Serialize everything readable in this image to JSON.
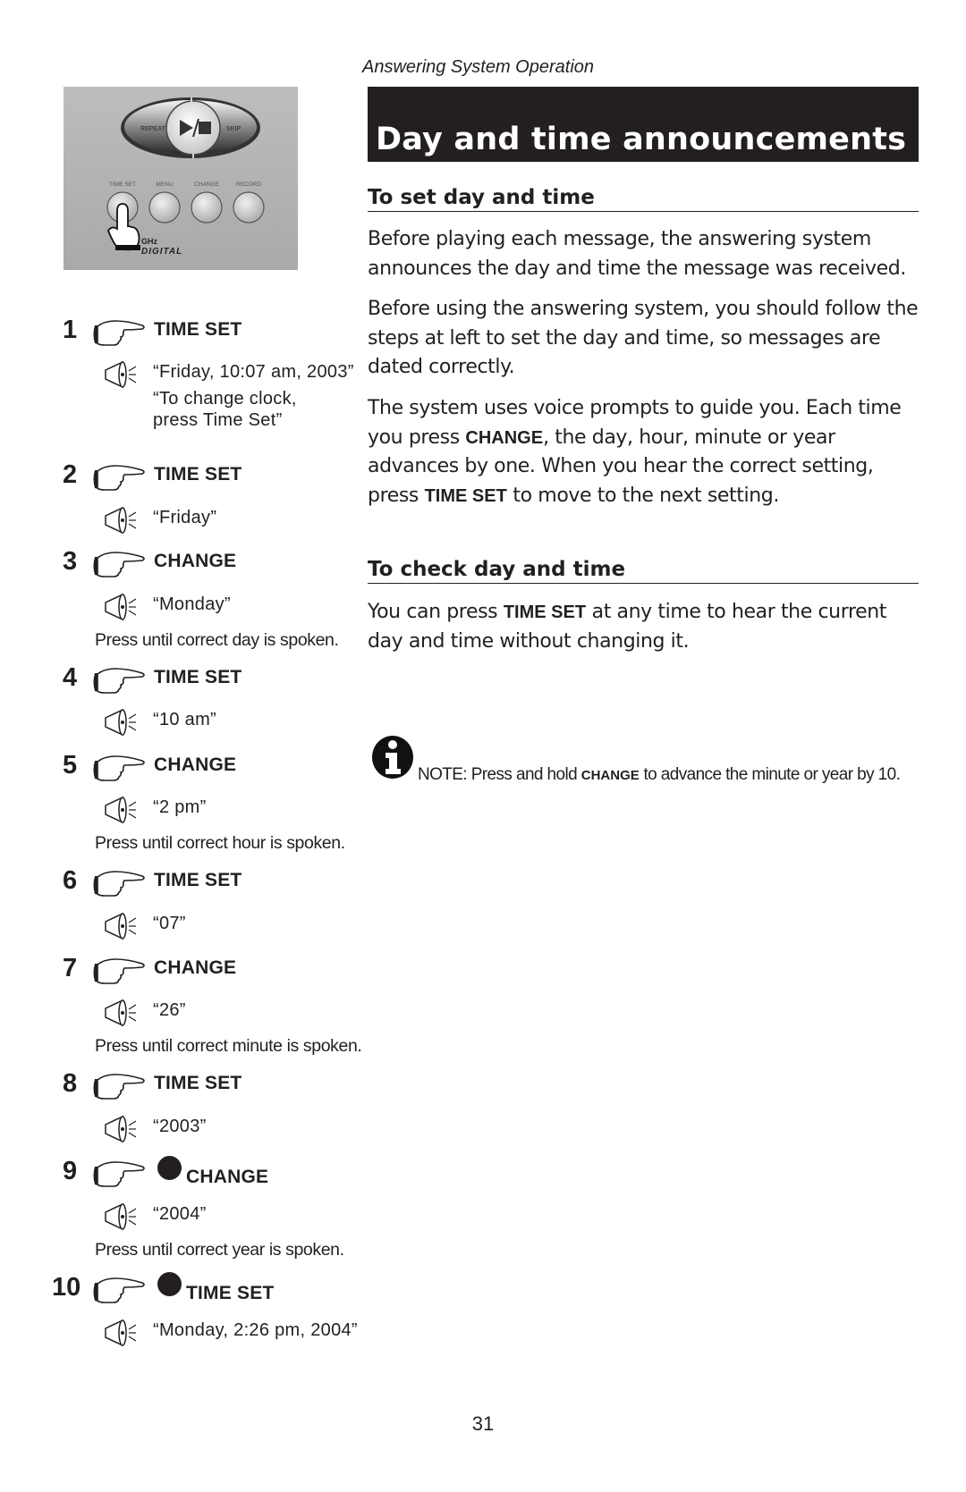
{
  "header": {
    "section_label": "Answering System Operation",
    "title": "Day and time announcements"
  },
  "phone_panel": {
    "top_buttons": {
      "left": "REPEAT",
      "center_icon": "play-stop-icon",
      "right": "SKIP"
    },
    "buttons": [
      "TIME SET",
      "MENU",
      "CHANGE",
      "RECORD"
    ],
    "logo": {
      "line1": "GHz",
      "line2": "DIGITAL"
    }
  },
  "steps": [
    {
      "num": "1",
      "action": "TIME SET",
      "hold": false,
      "says": [
        "“Friday, 10:07 am, 2003”",
        "“To change clock,",
        "press Time Set”"
      ],
      "hint": ""
    },
    {
      "num": "2",
      "action": "TIME SET",
      "hold": false,
      "says": [
        "“Friday”"
      ],
      "hint": ""
    },
    {
      "num": "3",
      "action": "CHANGE",
      "hold": false,
      "says": [
        "“Monday”"
      ],
      "hint": "Press until correct day is spoken."
    },
    {
      "num": "4",
      "action": "TIME SET",
      "hold": false,
      "says": [
        "“10 am”"
      ],
      "hint": ""
    },
    {
      "num": "5",
      "action": "CHANGE",
      "hold": false,
      "says": [
        "“2 pm”"
      ],
      "hint": "Press until correct hour is spoken."
    },
    {
      "num": "6",
      "action": "TIME SET",
      "hold": false,
      "says": [
        "“07”"
      ],
      "hint": ""
    },
    {
      "num": "7",
      "action": "CHANGE",
      "hold": false,
      "says": [
        "“26”"
      ],
      "hint": "Press until correct minute is spoken."
    },
    {
      "num": "8",
      "action": "TIME SET",
      "hold": false,
      "says": [
        "“2003”"
      ],
      "hint": ""
    },
    {
      "num": "9",
      "action": "CHANGE",
      "hold": true,
      "says": [
        "“2004”"
      ],
      "hint": "Press until correct year is spoken."
    },
    {
      "num": "10",
      "action": "TIME SET",
      "hold": true,
      "says": [
        "“Monday, 2:26 pm, 2004”"
      ],
      "hint": ""
    }
  ],
  "set_section": {
    "heading": "To set day and time",
    "p1": "Before playing each message, the answering system announces the day and time the message was received.",
    "p2": "Before using the answering system, you should follow the steps at left to set the day and time, so messages are dated correctly.",
    "p3_a": "The system uses voice prompts to guide you. Each time you press ",
    "p3_b": "CHANGE",
    "p3_c": ", the day, hour, minute or year advances by one. When you hear the correct setting, press ",
    "p3_d": "TIME SET",
    "p3_e": " to move to the next setting."
  },
  "check_section": {
    "heading": "To check day and time",
    "p_a": "You can press ",
    "p_b": "TIME SET",
    "p_c": " at any time to hear the current day and time without changing it."
  },
  "note": {
    "icon": "info-icon",
    "a": "NOTE: Press and hold ",
    "b": "CHANGE",
    "c": " to advance the minute or year by 10."
  },
  "page_number": "31"
}
